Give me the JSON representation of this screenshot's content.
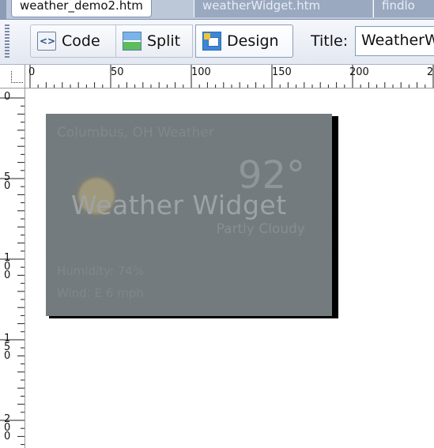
{
  "tabs": [
    {
      "label": "weather_demo2.htm",
      "active": true
    },
    {
      "label": "weatherWidget.htm",
      "active": false
    },
    {
      "label": "findlo",
      "active": false
    }
  ],
  "toolbar": {
    "code_label": "Code",
    "split_label": "Split",
    "design_label": "Design",
    "design_active": true,
    "title_label": "Title:",
    "title_value": "WeatherW"
  },
  "ruler": {
    "horizontal_labels": [
      "0",
      "50",
      "100",
      "150",
      "200",
      "25"
    ],
    "vertical_labels": [
      "0",
      "50",
      "100",
      "150",
      "200"
    ]
  },
  "widget": {
    "city": "Columbus, OH Weather",
    "temperature": "92°",
    "title": "Weather Widget",
    "condition": "Partly Cloudy",
    "humidity": "Humidity: 74%",
    "wind": "Wind: E 6 mph"
  },
  "colors": {
    "tab_strip": "#bcc7d8",
    "toolbar_bg": "#e3e8f1",
    "widget_bg": "#6c7478",
    "widget_text": "#9da3a5"
  }
}
